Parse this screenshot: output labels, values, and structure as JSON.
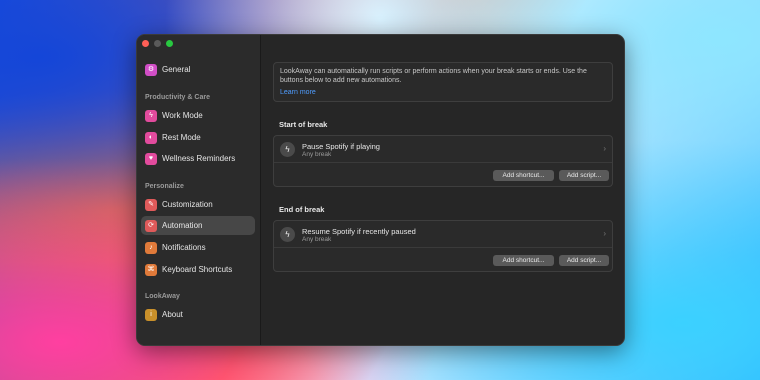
{
  "sidebar": {
    "items_top": [
      {
        "label": "General",
        "icon": "gear-icon",
        "color": "#d14ec6"
      }
    ],
    "sections": [
      {
        "title": "Productivity & Care",
        "items": [
          {
            "label": "Work Mode",
            "icon": "bolt-icon",
            "color": "#e24b9d"
          },
          {
            "label": "Rest Mode",
            "icon": "eye-off-icon",
            "color": "#e24b9d"
          },
          {
            "label": "Wellness Reminders",
            "icon": "wellness-icon",
            "color": "#e24b9d"
          }
        ]
      },
      {
        "title": "Personalize",
        "items": [
          {
            "label": "Customization",
            "icon": "brush-icon",
            "color": "#e05a5a"
          },
          {
            "label": "Automation",
            "icon": "automation-icon",
            "color": "#e05a5a"
          },
          {
            "label": "Notifications",
            "icon": "bell-icon",
            "color": "#e07a3a"
          },
          {
            "label": "Keyboard Shortcuts",
            "icon": "command-icon",
            "color": "#e07a3a"
          }
        ]
      },
      {
        "title": "LookAway",
        "items": [
          {
            "label": "About",
            "icon": "info-icon",
            "color": "#c9902a"
          }
        ]
      }
    ],
    "selected": "Automation"
  },
  "main": {
    "info_text": "LookAway can automatically run scripts or perform actions when your break starts or ends. Use the buttons below to add new automations.",
    "learn_more": "Learn more",
    "start": {
      "heading": "Start of break",
      "action_title": "Pause Spotify if playing",
      "action_sub": "Any break",
      "add_shortcut": "Add shortcut...",
      "add_script": "Add script..."
    },
    "end": {
      "heading": "End of break",
      "action_title": "Resume Spotify if recently paused",
      "action_sub": "Any break",
      "add_shortcut": "Add shortcut...",
      "add_script": "Add script..."
    }
  }
}
